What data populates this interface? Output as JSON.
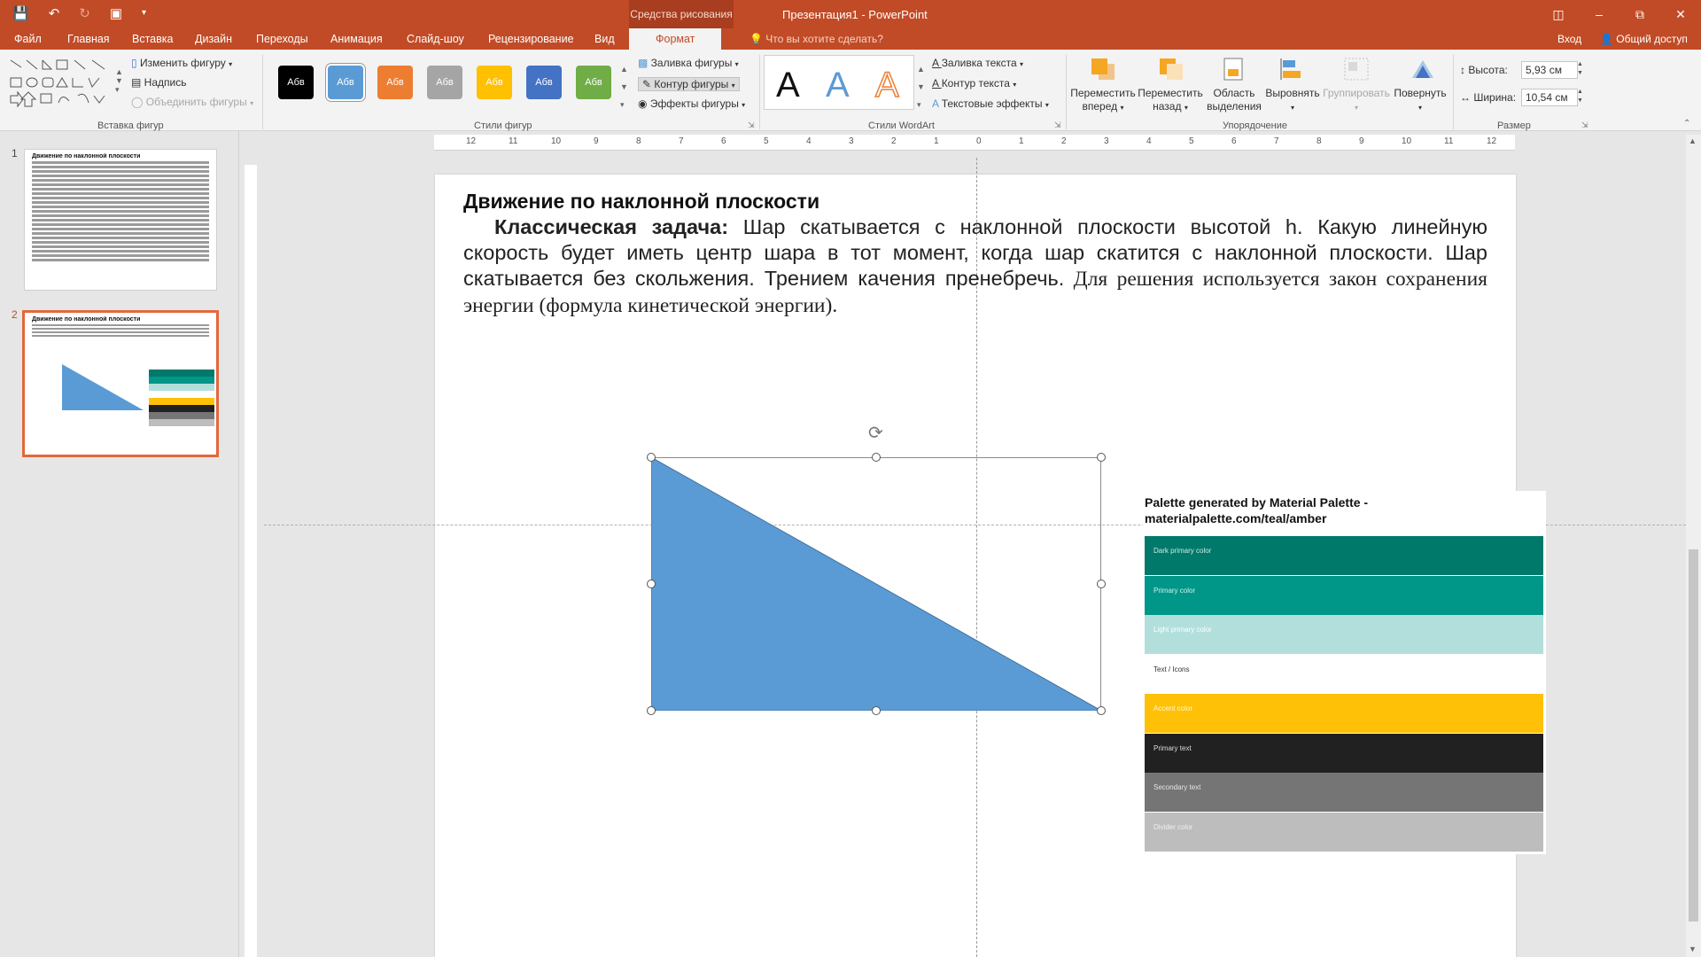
{
  "window": {
    "title": "Презентация1 - PowerPoint",
    "context_tab_header": "Средства рисования",
    "qat_icons": [
      "save-icon",
      "undo-icon",
      "redo-icon",
      "start-from-beginning-icon",
      "customize-icon"
    ],
    "controls": [
      "ribbon-display-icon",
      "minimize-icon",
      "restore-icon",
      "close-icon"
    ]
  },
  "tabs": [
    "Файл",
    "Главная",
    "Вставка",
    "Дизайн",
    "Переходы",
    "Анимация",
    "Слайд-шоу",
    "Рецензирование",
    "Вид",
    "Формат"
  ],
  "active_tab": "Формат",
  "tell_me": "Что вы хотите сделать?",
  "login": "Вход",
  "share": "Общий доступ",
  "ribbon": {
    "insert_shapes": {
      "label": "Вставка фигур",
      "edit_shape": "Изменить фигуру",
      "text_box": "Надпись",
      "merge_shapes": "Объединить фигуры"
    },
    "shape_styles": {
      "label": "Стили фигур",
      "sample": "Абв",
      "colors": [
        "#000000",
        "#5b9bd5",
        "#ed7d31",
        "#a5a5a5",
        "#ffc000",
        "#4472c4",
        "#70ad47"
      ],
      "fill": "Заливка фигуры",
      "outline": "Контур фигуры",
      "effects": "Эффекты фигуры"
    },
    "wordart": {
      "label": "Стили WordArt",
      "letter": "A",
      "text_fill": "Заливка текста",
      "text_outline": "Контур текста",
      "text_effects": "Текстовые эффекты"
    },
    "arrange": {
      "label": "Упорядочение",
      "bring_forward": [
        "Переместить",
        "вперед"
      ],
      "send_backward": [
        "Переместить",
        "назад"
      ],
      "selection_pane": [
        "Область",
        "выделения"
      ],
      "align": "Выровнять",
      "group": "Группировать",
      "rotate": "Повернуть"
    },
    "size": {
      "label": "Размер",
      "height_label": "Высота:",
      "height_value": "5,93 см",
      "width_label": "Ширина:",
      "width_value": "10,54 см"
    }
  },
  "ruler_ticks": [
    "12",
    "11",
    "10",
    "9",
    "8",
    "7",
    "6",
    "5",
    "4",
    "3",
    "2",
    "1",
    "0",
    "1",
    "2",
    "3",
    "4",
    "5",
    "6",
    "7",
    "8",
    "9",
    "10",
    "11",
    "12"
  ],
  "slides": [
    {
      "number": "1",
      "title": "Движение по наклонной плоскости"
    },
    {
      "number": "2",
      "title": "Движение по наклонной плоскости"
    }
  ],
  "slide": {
    "heading": "Движение по наклонной плоскости",
    "task_label": "Классическая задача:",
    "task_text": " Шар скатывается с наклонной плоскости высотой h. Какую линейную скорость будет иметь центр шара в тот момент, когда шар скатится с наклонной плоскости. Шар скатывается без скольжения. Трением качения пренебречь.",
    "task_text_serif": " Для решения используется закон сохранения энергии (формула кинетической энергии).",
    "triangle_color": "#5b9bd5",
    "palette_title": "Palette generated by Material Palette - materialpalette.com/teal/amber",
    "palette_rows": [
      {
        "label": "Dark primary color",
        "color": "#00796b",
        "text": "#cfeae6"
      },
      {
        "label": "Primary color",
        "color": "#009688",
        "text": "#d4f1ee"
      },
      {
        "label": "Light primary color",
        "color": "#b2dfdb",
        "text": "#ffffff"
      },
      {
        "label": "Text / Icons",
        "color": "#ffffff",
        "text": "#333333"
      },
      {
        "label": "Accent color",
        "color": "#ffc107",
        "text": "#fff6d6"
      },
      {
        "label": "Primary text",
        "color": "#212121",
        "text": "#dddddd"
      },
      {
        "label": "Secondary text",
        "color": "#757575",
        "text": "#e6e6e6"
      },
      {
        "label": "Divider color",
        "color": "#bdbdbd",
        "text": "#f0f0f0"
      }
    ]
  }
}
